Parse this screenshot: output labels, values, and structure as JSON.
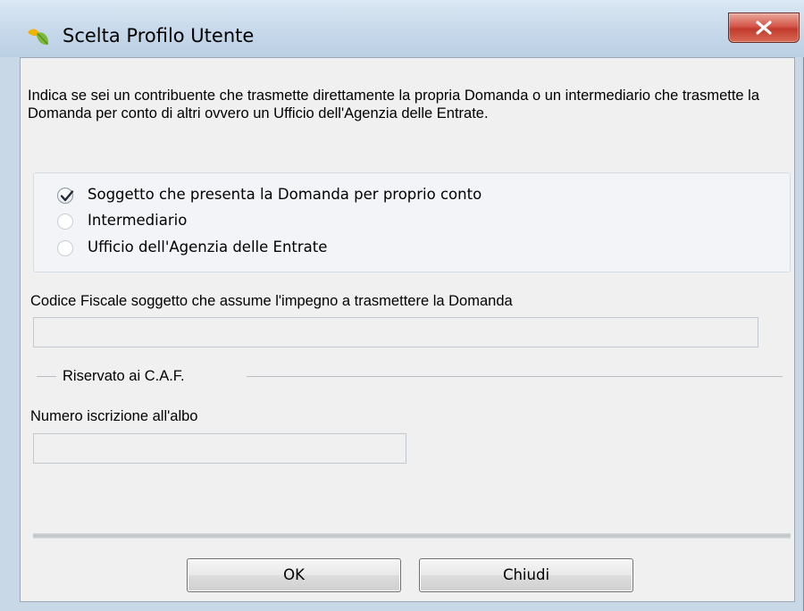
{
  "window": {
    "title": "Scelta Profilo Utente",
    "app_icon": "leaf-icon",
    "close_icon": "close-icon"
  },
  "intro_text": "Indica se sei un contribuente che trasmette direttamente la propria Domanda o un intermediario che trasmette la Domanda per conto di altri ovvero un Ufficio dell'Agenzia delle Entrate.",
  "profile_options": [
    {
      "label": "Soggetto che presenta la Domanda per proprio conto",
      "checked": true
    },
    {
      "label": "Intermediario",
      "checked": false
    },
    {
      "label": "Ufficio dell'Agenzia delle Entrate",
      "checked": false
    }
  ],
  "codice_fiscale": {
    "label": "Codice Fiscale soggetto che assume l'impegno a trasmettere la Domanda",
    "value": ""
  },
  "caf_section": {
    "title": "Riservato ai C.A.F.",
    "albo_label": "Numero iscrizione all'albo",
    "albo_value": ""
  },
  "buttons": {
    "ok": "OK",
    "close": "Chiudi"
  },
  "colors": {
    "title_bar": "#c6d8ea",
    "close_button": "#c23b2d",
    "dialog_bg": "#f0f0f0"
  }
}
